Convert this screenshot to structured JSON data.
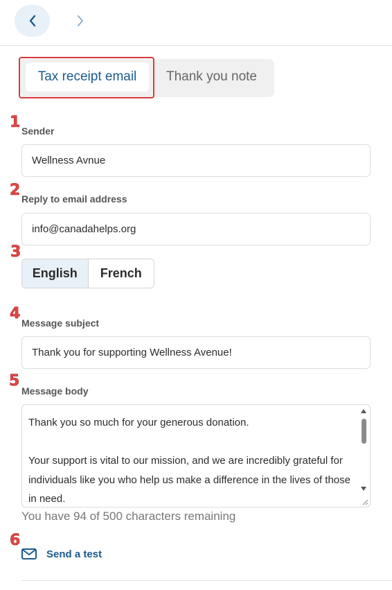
{
  "nav": {
    "back_icon": "chevron-left-icon",
    "forward_icon": "chevron-right-icon"
  },
  "tabs": [
    {
      "label": "Tax receipt email",
      "active": true
    },
    {
      "label": "Thank you note",
      "active": false
    }
  ],
  "markers": [
    "1",
    "2",
    "3",
    "4",
    "5",
    "6"
  ],
  "sender": {
    "label": "Sender",
    "value": "Wellness Avnue"
  },
  "reply_to": {
    "label": "Reply to email address",
    "value": "info@canadahelps.org"
  },
  "language": {
    "options": [
      "English",
      "French"
    ],
    "selected": "English"
  },
  "subject": {
    "label": "Message subject",
    "value": "Thank you for supporting Wellness Avenue!"
  },
  "body": {
    "label": "Message body",
    "value": "Thank you so much for your generous donation.\n\nYour support is vital to our mission, and we are incredibly grateful for individuals like you who help us make a difference in the lives of those in need."
  },
  "counter": "You have 94 of 500 characters remaining",
  "send_test": {
    "label": "Send a test",
    "icon": "envelope-icon"
  },
  "colors": {
    "accent": "#1b5a8f",
    "marker": "#e24848",
    "highlight": "#d83a3a"
  }
}
